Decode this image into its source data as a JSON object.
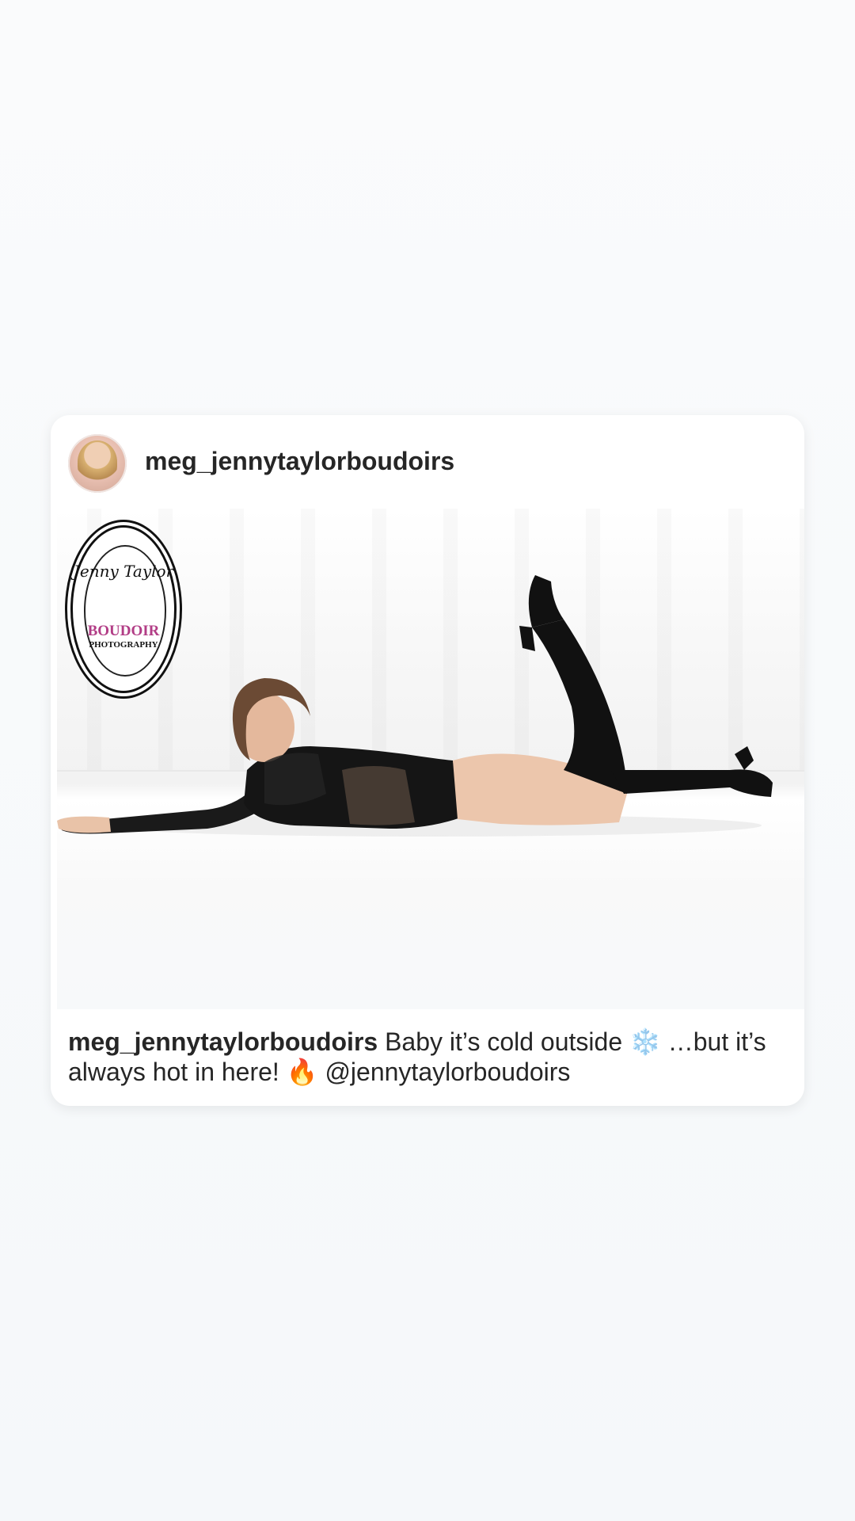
{
  "post": {
    "username": "meg_jennytaylorboudoirs",
    "caption_user": "meg_jennytaylorboudoirs",
    "caption_text": "Baby it’s cold outside ❄️ …but it’s always hot in here! 🔥 @jennytaylorboudoirs"
  },
  "watermark": {
    "script": "Jenny Taylor",
    "title": "BOUDOIR",
    "subtitle": "PHOTOGRAPHY"
  },
  "colors": {
    "background": "#f7f9fa",
    "card": "#ffffff",
    "text": "#262626",
    "watermark_accent": "#b23d86"
  }
}
